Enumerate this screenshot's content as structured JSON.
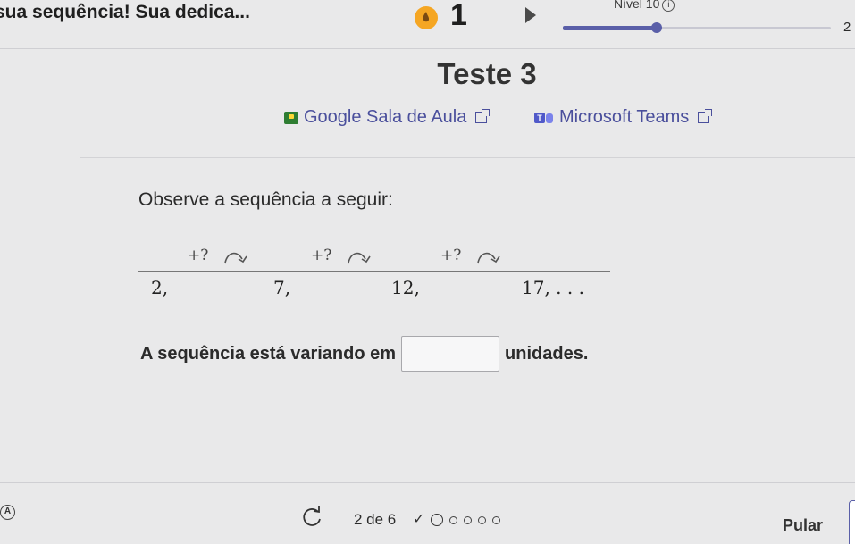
{
  "header": {
    "streak_message": "sua sequência! Sua dedica...",
    "streak_count": "1",
    "level_label": "Nível 10",
    "info_symbol": "i",
    "next_level": "2",
    "level_progress": 0.35
  },
  "title": "Teste 3",
  "share": {
    "classroom_label": "Google Sala de Aula",
    "teams_label": "Microsoft Teams",
    "teams_icon_letter": "T"
  },
  "question": {
    "prompt": "Observe a sequência a seguir:",
    "steps": [
      "+?",
      "+?",
      "+?"
    ],
    "terms": [
      "2,",
      "7,",
      "12,",
      "17, . . ."
    ],
    "answer_prefix": "A sequência está variando em",
    "answer_suffix": "unidades.",
    "answer_value": ""
  },
  "footer": {
    "accessibility_symbol": "A",
    "page_counter": "2 de 6",
    "check_symbol": "✓",
    "skip_label": "Pular"
  },
  "colors": {
    "accent": "#5a5fa8",
    "link": "#4a4f9c",
    "background": "#e9e9ea",
    "flame": "#f5a623"
  },
  "icons": [
    "flame-icon",
    "play-icon",
    "info-icon",
    "google-classroom-icon",
    "external-link-icon",
    "microsoft-teams-icon",
    "curved-arrow-icon",
    "accessibility-icon",
    "retry-icon",
    "check-icon"
  ]
}
